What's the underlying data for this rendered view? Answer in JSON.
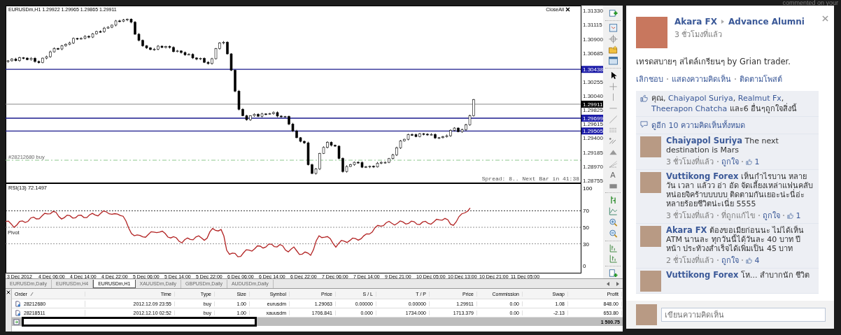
{
  "top_strip": {
    "notification_text": "commented on your"
  },
  "chart": {
    "header": "EURUSDm,H1  1.29922 1.29965 1.29865 1.29911",
    "close_all": "CloseAll",
    "order_line_label": "#28212680 buy",
    "status_text": "Spread: 8..  Next Bar in 41:38",
    "price_axis": [
      {
        "label": "1.31330",
        "kind": "tick"
      },
      {
        "label": "1.31115",
        "kind": "tick"
      },
      {
        "label": "1.30900",
        "kind": "tick"
      },
      {
        "label": "1.30685",
        "kind": "tick"
      },
      {
        "label": "1.30438",
        "kind": "line"
      },
      {
        "label": "1.30255",
        "kind": "tick"
      },
      {
        "label": "1.30040",
        "kind": "tick"
      },
      {
        "label": "1.29911",
        "kind": "bid"
      },
      {
        "label": "1.29825",
        "kind": "tick"
      },
      {
        "label": "1.29699",
        "kind": "line"
      },
      {
        "label": "1.29615",
        "kind": "tick"
      },
      {
        "label": "1.29505",
        "kind": "line"
      },
      {
        "label": "1.29400",
        "kind": "tick"
      },
      {
        "label": "1.29185",
        "kind": "tick"
      },
      {
        "label": "1.28970",
        "kind": "tick"
      },
      {
        "label": "1.28755",
        "kind": "tick"
      }
    ],
    "rsi": {
      "label": "RSI(13) 72.1497",
      "pivot_label": "Pivot",
      "axis": [
        "100",
        "70",
        "50",
        "30",
        "0"
      ]
    },
    "time_axis": [
      "3 Dec 2012",
      "4 Dec 06:00",
      "4 Dec 14:00",
      "4 Dec 22:00",
      "5 Dec 06:00",
      "5 Dec 14:00",
      "5 Dec 22:00",
      "6 Dec 06:00",
      "6 Dec 14:00",
      "6 Dec 22:00",
      "7 Dec 06:00",
      "7 Dec 14:00",
      "9 Dec 21:00",
      "10 Dec 05:00",
      "10 Dec 13:00",
      "10 Dec 21:00",
      "11 Dec 05:00"
    ]
  },
  "toolbar": {
    "text_tool": "A"
  },
  "tabs": [
    {
      "label": "EURUSDm,Daily",
      "selected": false
    },
    {
      "label": "EURUSDm,H4",
      "selected": false
    },
    {
      "label": "EURUSDm,H1",
      "selected": true
    },
    {
      "label": "XAUUSDm,Daily",
      "selected": false
    },
    {
      "label": "GBPUSDm,Daily",
      "selected": false
    },
    {
      "label": "AUDUSDm,Daily",
      "selected": false
    }
  ],
  "orders": {
    "columns": [
      "Order",
      "Time",
      "Type",
      "Size",
      "Symbol",
      "Price",
      "S / L",
      "T / P",
      "Price",
      "Commission",
      "Swap",
      "Profit"
    ],
    "rows": [
      [
        "28212680",
        "2012.12.09 23:55",
        "buy",
        "1.00",
        "eurusdm",
        "1.29063",
        "0.00000",
        "0.00000",
        "1.29911",
        "0.00",
        "1.08",
        "848.00"
      ],
      [
        "28218511",
        "2012.12.10 02:52",
        "buy",
        "1.00",
        "xauusdm",
        "1706.841",
        "0.000",
        "1734.000",
        "1713.379",
        "0.00",
        "-2.13",
        "653.80"
      ]
    ],
    "total": "1 500.75"
  },
  "post": {
    "author": "Akara FX",
    "group": "Advance Alumni",
    "time": "3 ชั่วโมงที่แล้ว",
    "text": "เทรดสบายๆ สไตล์เกรียนๆ by Grian trader.",
    "actions": [
      "เลิกชอบ",
      "แสดงความคิดเห็น",
      "ติดตามโพสต์"
    ],
    "likes": [
      {
        "text": "คุณ, ",
        "link": false
      },
      {
        "text": "Chaiyapol Suriya",
        "link": true
      },
      {
        "text": ", ",
        "link": false
      },
      {
        "text": "Realmut Fx",
        "link": true
      },
      {
        "text": ", ",
        "link": false
      },
      {
        "text": "Theerapon Chatcha",
        "link": true
      },
      {
        "text": " และ6 อื่นๆถูกใจสิ่งนี้",
        "link": false
      }
    ],
    "view_more": "ดูอีก 10 ความคิดเห็นทั้งหมด",
    "comments": [
      {
        "author": "Chaiyapol Suriya",
        "text": "The next destination is Mars",
        "time": "3 ชั่วโมงที่แล้ว",
        "like_link": "ถูกใจ",
        "likes": "1"
      },
      {
        "author": "Vuttikong Forex",
        "text": "เห็นกำไรบาน หลาย วัน เวลา แล้วว อ่า อัด จัดเลี้ยงเหล่าแฟนคลับ หน่อยจิคร้าบบบบบ ติดตามกันเยอะน่ะนี่อ่ะ หลายร้อยชีวิตน่ะเนี่ย 5555",
        "time": "3 ชั่วโมงที่แล้ว",
        "edited": "ที่ถูกแก้ไข",
        "like_link": "ถูกใจ",
        "likes": "1"
      },
      {
        "author": "Akara FX",
        "text": "ต้องขอเมียก่อนนะ ไม่ได้เห็น ATM นานละ ทุกวันนี้ได้วันละ 40 บาท ปีหน้า ประท้วงสำเร็จได้เพิ่มเป็น 45 บาท",
        "time": "2 ชั่วโมงที่แล้ว",
        "like_link": "ถูกใจ",
        "likes": "4"
      },
      {
        "author": "Vuttikong Forex",
        "text": "โห... สำบากนัก ชีวิต"
      }
    ],
    "composer": {
      "placeholder": "เขียนความคิดเห็น"
    }
  }
}
